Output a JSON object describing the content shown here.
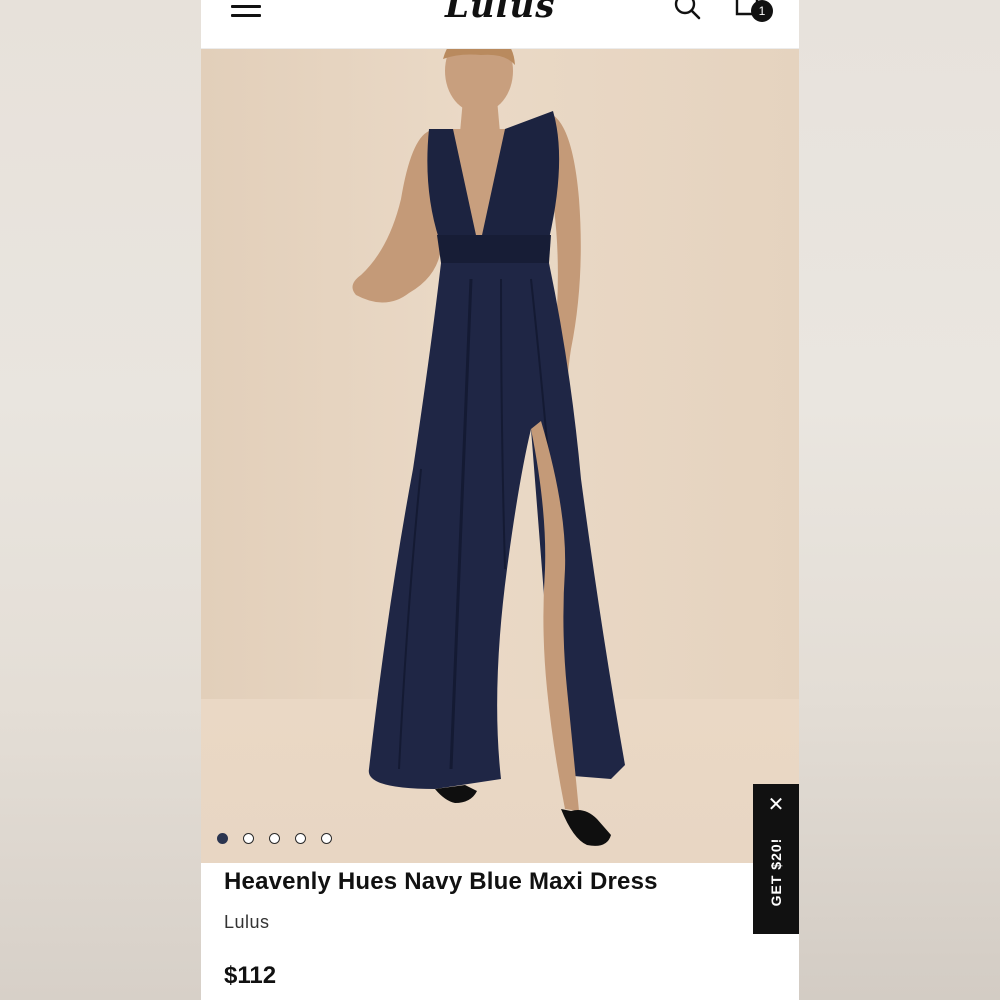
{
  "header": {
    "logo_text": "Lulus",
    "cart_count": "1"
  },
  "icons": {
    "menu": "hamburger-menu-icon",
    "search": "search-icon",
    "cart": "cart-icon",
    "close": "close-icon"
  },
  "gallery": {
    "image_description": "model wearing navy blue maxi dress",
    "dot_count": 5,
    "active_index": 0
  },
  "promo": {
    "label": "GET $20!",
    "close_symbol": "✕"
  },
  "product": {
    "title": "Heavenly Hues Navy Blue Maxi Dress",
    "brand": "Lulus",
    "price": "$112"
  },
  "colors": {
    "dress": "#1c2340",
    "background": "#e6d5c2",
    "promo_bg": "#111111"
  }
}
